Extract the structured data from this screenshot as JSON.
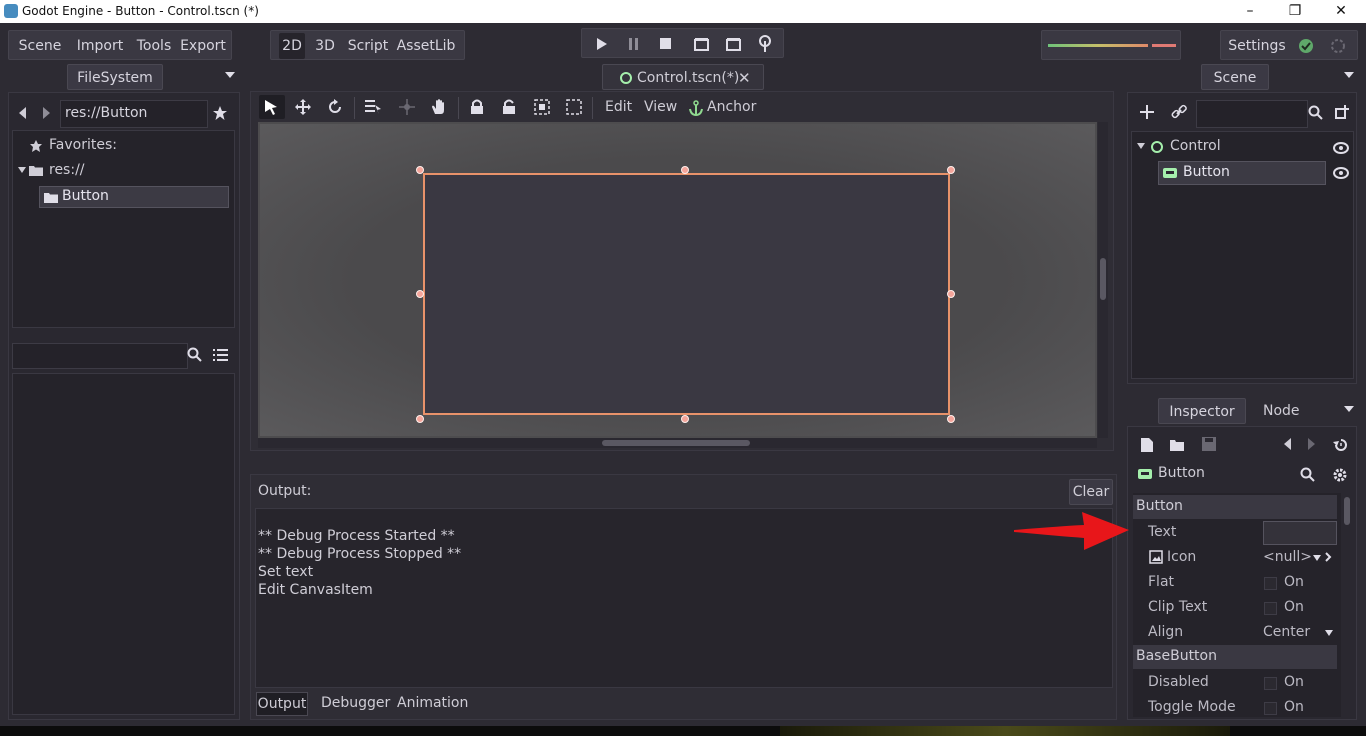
{
  "window": {
    "title": "Godot Engine - Button - Control.tscn (*)",
    "min": "–",
    "max": "❐",
    "close": "✕"
  },
  "menu": {
    "scene": "Scene",
    "import": "Import",
    "tools": "Tools",
    "export": "Export"
  },
  "workspaces": {
    "w2d": "2D",
    "w3d": "3D",
    "script": "Script",
    "assetlib": "AssetLib"
  },
  "settings_label": "Settings",
  "filesystem": {
    "tab": "FileSystem",
    "path": "res://Button",
    "favorites": "Favorites:",
    "res": "res://",
    "folder": "Button",
    "search_placeholder": ""
  },
  "scene_tab": {
    "label": "Control.tscn(*)",
    "close": "✕"
  },
  "viewport_toolbar": {
    "edit": "Edit",
    "view": "View",
    "anchor": "Anchor"
  },
  "output": {
    "title": "Output:",
    "clear": "Clear",
    "lines": [
      "** Debug Process Started **",
      "** Debug Process Stopped **",
      "Set text",
      "Edit CanvasItem"
    ],
    "tabs": [
      "Output",
      "Debugger",
      "Animation"
    ]
  },
  "scene_dock": {
    "tab": "Scene",
    "root": "Control",
    "child": "Button"
  },
  "inspector": {
    "tab_inspector": "Inspector",
    "tab_node": "Node",
    "object": "Button",
    "section_button": "Button",
    "text_label": "Text",
    "text_value": "",
    "icon_label": "Icon",
    "icon_value": "<null>",
    "flat_label": "Flat",
    "clip_label": "Clip Text",
    "align_label": "Align",
    "align_value": "Center",
    "section_base": "BaseButton",
    "disabled_label": "Disabled",
    "toggle_label": "Toggle Mode",
    "on": "On"
  },
  "colors": {
    "accent": "#e8926a",
    "handle": "#f4a59b",
    "arrow": "#e8161a",
    "bg": "#2d2b33"
  }
}
